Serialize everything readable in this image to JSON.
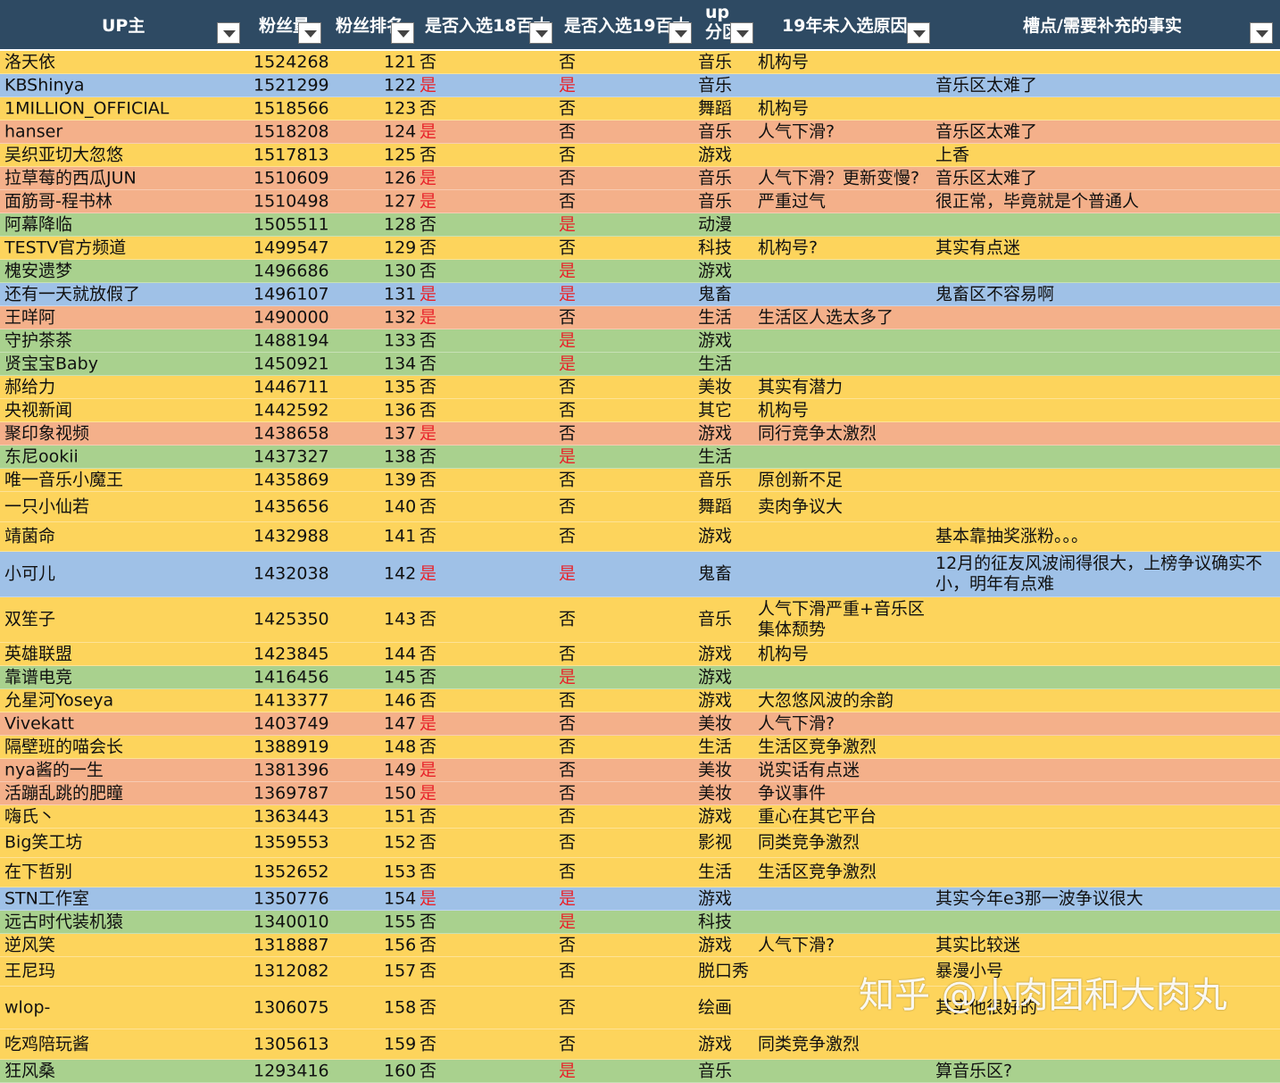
{
  "headers": {
    "up": "UP主",
    "fans": "粉丝量",
    "rank": "粉丝排名",
    "in18": "是否入选18百大",
    "in19": "是否入选19百大",
    "zone": "up分区",
    "reason": "19年未入选原因",
    "note": "槽点/需要补充的事实"
  },
  "colors": {
    "header": "#2e4a63",
    "yellow": "#fdd45c",
    "blue": "#9fc1e7",
    "orange": "#f4b08a",
    "green": "#a9d18e",
    "red_text": "#e8232a"
  },
  "rows": [
    {
      "name": "洛天依",
      "fans": "1524268",
      "rank": "121",
      "in18": "否",
      "in19": "否",
      "zone": "音乐",
      "reason": "机构号",
      "note": "",
      "color": "y"
    },
    {
      "name": "KBShinya",
      "fans": "1521299",
      "rank": "122",
      "in18": "是",
      "in19": "是",
      "zone": "音乐",
      "reason": "",
      "note": "音乐区太难了",
      "color": "b"
    },
    {
      "name": "1MILLION_OFFICIAL",
      "fans": "1518566",
      "rank": "123",
      "in18": "否",
      "in19": "否",
      "zone": "舞蹈",
      "reason": "机构号",
      "note": "",
      "color": "y"
    },
    {
      "name": "hanser",
      "fans": "1518208",
      "rank": "124",
      "in18": "是",
      "in19": "否",
      "zone": "音乐",
      "reason": "人气下滑?",
      "note": "音乐区太难了",
      "color": "o"
    },
    {
      "name": "吴织亚切大忽悠",
      "fans": "1517813",
      "rank": "125",
      "in18": "否",
      "in19": "否",
      "zone": "游戏",
      "reason": "",
      "note": "上香",
      "color": "y"
    },
    {
      "name": "拉草莓的西瓜JUN",
      "fans": "1510609",
      "rank": "126",
      "in18": "是",
      "in19": "否",
      "zone": "音乐",
      "reason": "人气下滑？更新变慢?",
      "note": "音乐区太难了",
      "color": "o"
    },
    {
      "name": "面筋哥-程书林",
      "fans": "1510498",
      "rank": "127",
      "in18": "是",
      "in19": "否",
      "zone": "音乐",
      "reason": "严重过气",
      "note": "很正常，毕竟就是个普通人",
      "color": "o"
    },
    {
      "name": "阿幕降临",
      "fans": "1505511",
      "rank": "128",
      "in18": "否",
      "in19": "是",
      "zone": "动漫",
      "reason": "",
      "note": "",
      "color": "g"
    },
    {
      "name": "TESTV官方频道",
      "fans": "1499547",
      "rank": "129",
      "in18": "否",
      "in19": "否",
      "zone": "科技",
      "reason": "机构号?",
      "note": "其实有点迷",
      "color": "y"
    },
    {
      "name": "槐安遗梦",
      "fans": "1496686",
      "rank": "130",
      "in18": "否",
      "in19": "是",
      "zone": "游戏",
      "reason": "",
      "note": "",
      "color": "g"
    },
    {
      "name": "还有一天就放假了",
      "fans": "1496107",
      "rank": "131",
      "in18": "是",
      "in19": "是",
      "zone": "鬼畜",
      "reason": "",
      "note": "鬼畜区不容易啊",
      "color": "b"
    },
    {
      "name": "王咩阿",
      "fans": "1490000",
      "rank": "132",
      "in18": "是",
      "in19": "否",
      "zone": "生活",
      "reason": "生活区人选太多了",
      "note": "",
      "color": "o"
    },
    {
      "name": "守护茶茶",
      "fans": "1488194",
      "rank": "133",
      "in18": "否",
      "in19": "是",
      "zone": "游戏",
      "reason": "",
      "note": "",
      "color": "g"
    },
    {
      "name": "贤宝宝Baby",
      "fans": "1450921",
      "rank": "134",
      "in18": "否",
      "in19": "是",
      "zone": "生活",
      "reason": "",
      "note": "",
      "color": "g"
    },
    {
      "name": "郝给力",
      "fans": "1446711",
      "rank": "135",
      "in18": "否",
      "in19": "否",
      "zone": "美妆",
      "reason": "其实有潜力",
      "note": "",
      "color": "y"
    },
    {
      "name": "央视新闻",
      "fans": "1442592",
      "rank": "136",
      "in18": "否",
      "in19": "否",
      "zone": "其它",
      "reason": "机构号",
      "note": "",
      "color": "y"
    },
    {
      "name": "聚印象视频",
      "fans": "1438658",
      "rank": "137",
      "in18": "是",
      "in19": "否",
      "zone": "游戏",
      "reason": "同行竞争太激烈",
      "note": "",
      "color": "o"
    },
    {
      "name": "东尼ookii",
      "fans": "1437327",
      "rank": "138",
      "in18": "否",
      "in19": "是",
      "zone": "生活",
      "reason": "",
      "note": "",
      "color": "g"
    },
    {
      "name": "唯一音乐小魔王",
      "fans": "1435869",
      "rank": "139",
      "in18": "否",
      "in19": "否",
      "zone": "音乐",
      "reason": "原创新不足",
      "note": "",
      "color": "y"
    },
    {
      "name": "一只小仙若",
      "fans": "1435656",
      "rank": "140",
      "in18": "否",
      "in19": "否",
      "zone": "舞蹈",
      "reason": "卖肉争议大",
      "note": "",
      "color": "y"
    },
    {
      "name": "靖菌命",
      "fans": "1432988",
      "rank": "141",
      "in18": "否",
      "in19": "否",
      "zone": "游戏",
      "reason": "",
      "note": "基本靠抽奖涨粉。。。",
      "color": "y"
    },
    {
      "name": "小可儿",
      "fans": "1432038",
      "rank": "142",
      "in18": "是",
      "in19": "是",
      "zone": "鬼畜",
      "reason": "",
      "note": "12月的征友风波闹得很大，上榜争议确实不小，明年有点难",
      "color": "b"
    },
    {
      "name": "双笙子",
      "fans": "1425350",
      "rank": "143",
      "in18": "否",
      "in19": "否",
      "zone": "音乐",
      "reason": "人气下滑严重+音乐区集体颓势",
      "note": "",
      "color": "y"
    },
    {
      "name": "英雄联盟",
      "fans": "1423845",
      "rank": "144",
      "in18": "否",
      "in19": "否",
      "zone": "游戏",
      "reason": "机构号",
      "note": "",
      "color": "y"
    },
    {
      "name": "靠谱电竞",
      "fans": "1416456",
      "rank": "145",
      "in18": "否",
      "in19": "是",
      "zone": "游戏",
      "reason": "",
      "note": "",
      "color": "g"
    },
    {
      "name": "允星河Yoseya",
      "fans": "1413377",
      "rank": "146",
      "in18": "否",
      "in19": "否",
      "zone": "游戏",
      "reason": "大忽悠风波的余韵",
      "note": "",
      "color": "y"
    },
    {
      "name": "Vivekatt",
      "fans": "1403749",
      "rank": "147",
      "in18": "是",
      "in19": "否",
      "zone": "美妆",
      "reason": "人气下滑?",
      "note": "",
      "color": "o"
    },
    {
      "name": "隔壁班的喵会长",
      "fans": "1388919",
      "rank": "148",
      "in18": "否",
      "in19": "否",
      "zone": "生活",
      "reason": "生活区竞争激烈",
      "note": "",
      "color": "y"
    },
    {
      "name": "nya酱的一生",
      "fans": "1381396",
      "rank": "149",
      "in18": "是",
      "in19": "否",
      "zone": "美妆",
      "reason": "说实话有点迷",
      "note": "",
      "color": "o"
    },
    {
      "name": "活蹦乱跳的肥瞳",
      "fans": "1369787",
      "rank": "150",
      "in18": "是",
      "in19": "否",
      "zone": "美妆",
      "reason": "争议事件",
      "note": "",
      "color": "o"
    },
    {
      "name": "嗨氏丶",
      "fans": "1363443",
      "rank": "151",
      "in18": "否",
      "in19": "否",
      "zone": "游戏",
      "reason": "重心在其它平台",
      "note": "",
      "color": "y"
    },
    {
      "name": "Big笑工坊",
      "fans": "1359553",
      "rank": "152",
      "in18": "否",
      "in19": "否",
      "zone": "影视",
      "reason": "同类竞争激烈",
      "note": "",
      "color": "y"
    },
    {
      "name": "在下哲别",
      "fans": "1352652",
      "rank": "153",
      "in18": "否",
      "in19": "否",
      "zone": "生活",
      "reason": "生活区竞争激烈",
      "note": "",
      "color": "y"
    },
    {
      "name": "STN工作室",
      "fans": "1350776",
      "rank": "154",
      "in18": "是",
      "in19": "是",
      "zone": "游戏",
      "reason": "",
      "note": "其实今年e3那一波争议很大",
      "color": "b"
    },
    {
      "name": "远古时代装机猿",
      "fans": "1340010",
      "rank": "155",
      "in18": "否",
      "in19": "是",
      "zone": "科技",
      "reason": "",
      "note": "",
      "color": "g"
    },
    {
      "name": "逆风笑",
      "fans": "1318887",
      "rank": "156",
      "in18": "否",
      "in19": "否",
      "zone": "游戏",
      "reason": "人气下滑?",
      "note": "其实比较迷",
      "color": "y"
    },
    {
      "name": "王尼玛",
      "fans": "1312082",
      "rank": "157",
      "in18": "否",
      "in19": "否",
      "zone": "脱口秀",
      "reason": "",
      "note": "暴漫小号",
      "color": "y"
    },
    {
      "name": "wlop-",
      "fans": "1306075",
      "rank": "158",
      "in18": "否",
      "in19": "否",
      "zone": "绘画",
      "reason": "",
      "note": "其实他很好的",
      "color": "y"
    },
    {
      "name": "吃鸡陪玩酱",
      "fans": "1305613",
      "rank": "159",
      "in18": "否",
      "in19": "否",
      "zone": "游戏",
      "reason": "同类竞争激烈",
      "note": "",
      "color": "y"
    },
    {
      "name": "狂风桑",
      "fans": "1293416",
      "rank": "160",
      "in18": "否",
      "in19": "是",
      "zone": "音乐",
      "reason": "",
      "note": "算音乐区?",
      "color": "g"
    }
  ],
  "watermark": "知乎 @小肉团和大肉丸"
}
